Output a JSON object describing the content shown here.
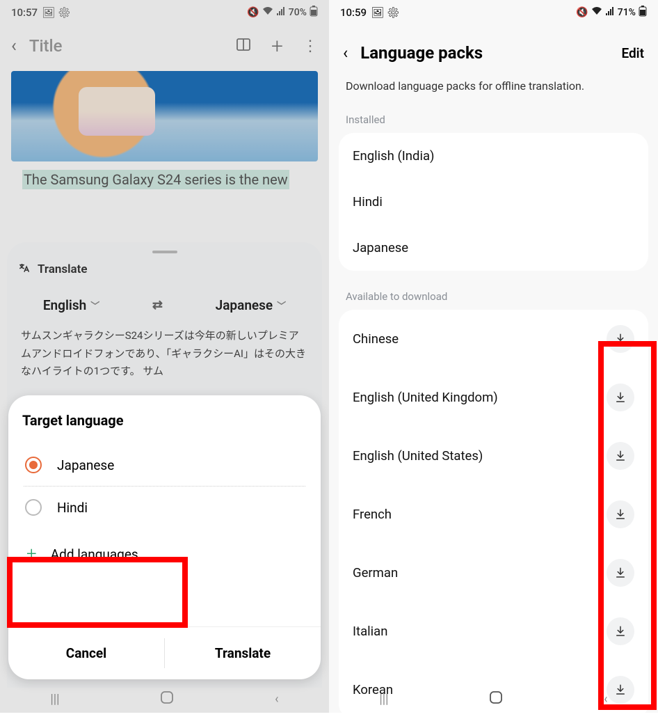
{
  "left": {
    "status": {
      "time": "10:57",
      "battery": "70%",
      "icons": "🖼 ⚙"
    },
    "header": {
      "title": "Title"
    },
    "highlighted_text": "The Samsung Galaxy S24 series is the new",
    "translate": {
      "label": "Translate",
      "source_lang": "English",
      "target_lang": "Japanese",
      "output": "サムスンギャラクシーS24シリーズは今年の新しいプレミアムアンドロイドフォンであり、「ギャラクシーAI」はその大きなハイライトの1つです。 サム"
    },
    "target_card": {
      "title": "Target language",
      "options": [
        {
          "label": "Japanese",
          "selected": true
        },
        {
          "label": "Hindi",
          "selected": false
        }
      ],
      "add_label": "Add languages",
      "cancel": "Cancel",
      "confirm": "Translate"
    }
  },
  "right": {
    "status": {
      "time": "10:59",
      "battery": "71%",
      "icons": "🖼 ⚙"
    },
    "header": {
      "title": "Language packs",
      "edit": "Edit"
    },
    "subtitle": "Download language packs for offline translation.",
    "sections": {
      "installed_label": "Installed",
      "installed": [
        "English (India)",
        "Hindi",
        "Japanese"
      ],
      "available_label": "Available to download",
      "available": [
        "Chinese",
        "English (United Kingdom)",
        "English (United States)",
        "French",
        "German",
        "Italian",
        "Korean"
      ]
    }
  }
}
